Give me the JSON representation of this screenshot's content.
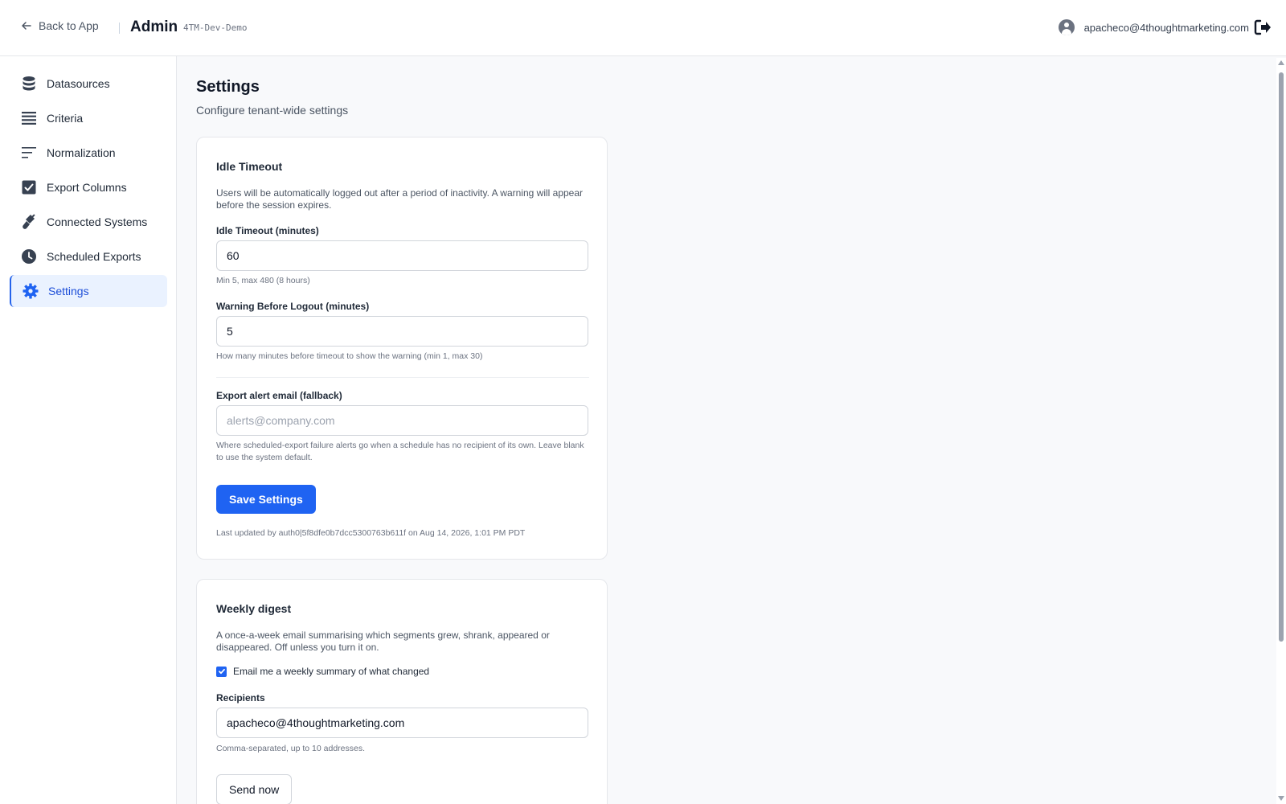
{
  "header": {
    "back_label": "Back to App",
    "title": "Admin",
    "tenant": "4TM-Dev-Demo",
    "user_email": "apacheco@4thoughtmarketing.com"
  },
  "sidebar": {
    "items": [
      {
        "label": "Datasources",
        "icon": "database-icon"
      },
      {
        "label": "Criteria",
        "icon": "list-icon"
      },
      {
        "label": "Normalization",
        "icon": "lines-icon"
      },
      {
        "label": "Export Columns",
        "icon": "check-square-icon"
      },
      {
        "label": "Connected Systems",
        "icon": "plug-icon"
      },
      {
        "label": "Scheduled Exports",
        "icon": "clock-icon"
      },
      {
        "label": "Settings",
        "icon": "gear-icon",
        "active": true
      }
    ]
  },
  "page": {
    "title": "Settings",
    "subtitle": "Configure tenant-wide settings"
  },
  "idle_timeout": {
    "title": "Idle Timeout",
    "description": "Users will be automatically logged out after a period of inactivity. A warning will appear before the session expires.",
    "timeout_label": "Idle Timeout (minutes)",
    "timeout_value": "60",
    "timeout_hint": "Min 5, max 480 (8 hours)",
    "warning_label": "Warning Before Logout (minutes)",
    "warning_value": "5",
    "warning_hint": "How many minutes before timeout to show the warning (min 1, max 30)",
    "alert_email_label": "Export alert email (fallback)",
    "alert_email_placeholder": "alerts@company.com",
    "alert_email_hint": "Where scheduled-export failure alerts go when a schedule has no recipient of its own. Leave blank to use the system default.",
    "save_label": "Save Settings",
    "last_updated": "Last updated by auth0|5f8dfe0b7dcc5300763b611f on Aug 14, 2026, 1:01 PM PDT"
  },
  "weekly_digest": {
    "title": "Weekly digest",
    "description": "A once-a-week email summarising which segments grew, shrank, appeared or disappeared. Off unless you turn it on.",
    "checkbox_label": "Email me a weekly summary of what changed",
    "checkbox_checked": true,
    "recipients_label": "Recipients",
    "recipients_value": "apacheco@4thoughtmarketing.com",
    "recipients_hint": "Comma-separated, up to 10 addresses.",
    "send_now_label": "Send now"
  },
  "colors": {
    "accent": "#1f63f2",
    "active_nav_bg": "#eaf2ff",
    "active_nav_text": "#1d4ed8"
  }
}
